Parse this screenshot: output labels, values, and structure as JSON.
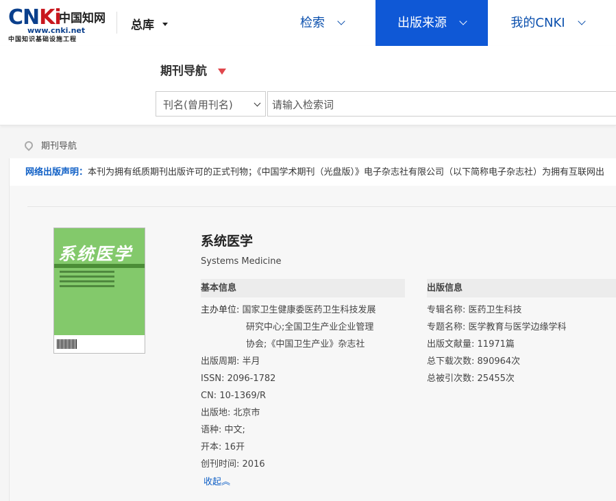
{
  "header": {
    "logo": {
      "brand": "CNKi",
      "brand_cn": "中国知网",
      "url": "www.cnki.net",
      "subtitle": "中国知识基础设施工程"
    },
    "library_label": "总库",
    "nav": [
      {
        "label": "检索"
      },
      {
        "label": "出版来源",
        "active": true
      },
      {
        "label": "我的CNKI"
      }
    ],
    "accent_color": "#0f58d6"
  },
  "search": {
    "section_label": "期刊导航",
    "field_select": "刊名(曾用刊名)",
    "placeholder": "请输入检索词"
  },
  "breadcrumb": "期刊导航",
  "notice": {
    "lead": "网络出版声明：",
    "text": "本刊为拥有纸质期刊出版许可的正式刊物；《中国学术期刊（光盘版）》电子杂志社有限公司（以下简称电子杂志社）为拥有互联网出"
  },
  "journal": {
    "cover_title": "系统医学",
    "title": "系统医学",
    "english_title": "Systems Medicine",
    "basic_info_heading": "基本信息",
    "basic": {
      "sponsor_key": "主办单位:",
      "sponsor_lines": [
        "国家卫生健康委医药卫生科技发展",
        "研究中心;全国卫生产业企业管理",
        "协会;《中国卫生产业》杂志社"
      ],
      "period_key": "出版周期:",
      "period": "半月",
      "issn_key": "ISSN:",
      "issn": "2096-1782",
      "cn_key": "CN:",
      "cn": "10-1369/R",
      "place_key": "出版地:",
      "place": "北京市",
      "lang_key": "语种:",
      "lang": "中文;",
      "format_key": "开本:",
      "format": "16开",
      "founded_key": "创刊时间:",
      "founded": "2016"
    },
    "pub_info_heading": "出版信息",
    "pub": {
      "album_key": "专辑名称:",
      "album": "医药卫生科技",
      "topic_key": "专题名称:",
      "topic": "医学教育与医学边缘学科",
      "count_key": "出版文献量:",
      "count": "11971篇",
      "downloads_key": "总下载次数:",
      "downloads": "890964次",
      "cites_key": "总被引次数:",
      "cites": "25455次"
    },
    "collapse_label": "收起︽"
  }
}
